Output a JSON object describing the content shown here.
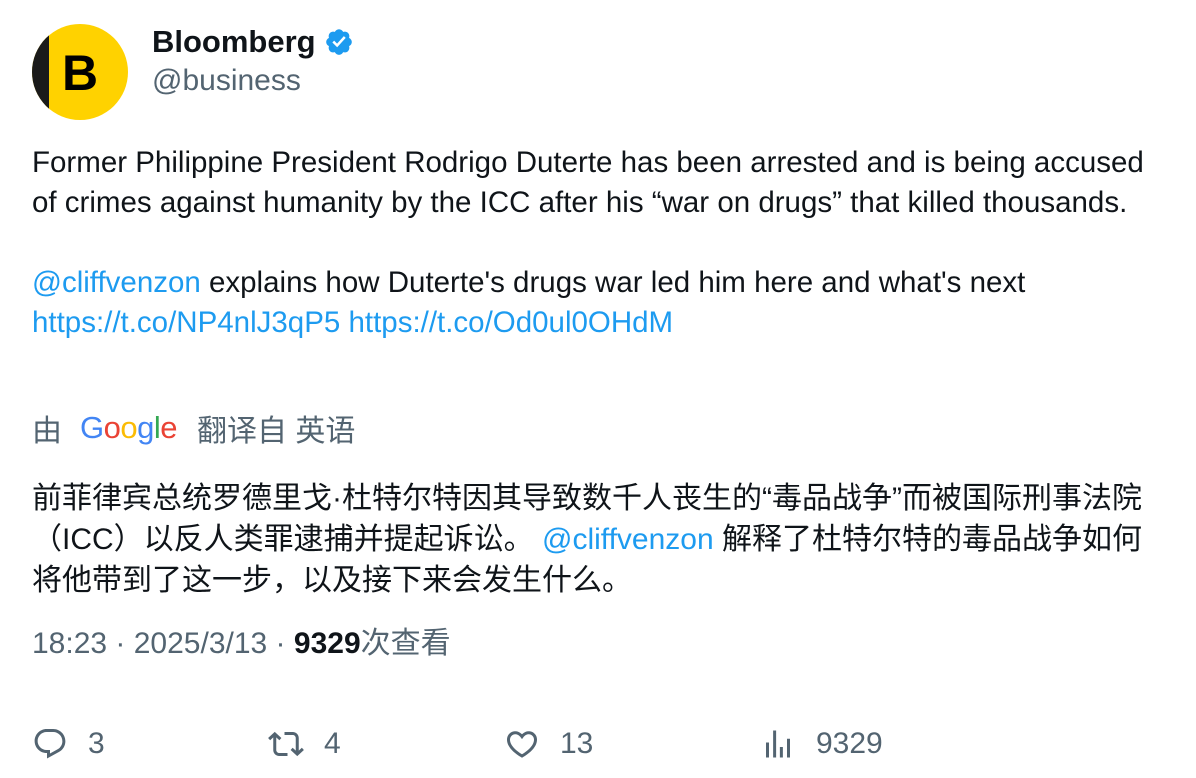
{
  "author": {
    "display_name": "Bloomberg",
    "handle": "@business",
    "avatar_letter": "B",
    "verified": true,
    "avatar_color": "#ffd200",
    "verified_color": "#1d9bf0"
  },
  "tweet": {
    "paragraph1": "Former Philippine President Rodrigo Duterte has been arrested and is being accused of crimes against humanity by the ICC after his “war on drugs” that killed thousands.",
    "mention": "@cliffvenzon",
    "paragraph2_text": " explains how Duterte's drugs war led him here and what's next",
    "link1": "https://t.co/NP4nlJ3qP5",
    "link2": "https://t.co/Od0ul0OHdM"
  },
  "translation": {
    "prefix": "由",
    "provider_letters": [
      "G",
      "o",
      "o",
      "g",
      "l",
      "e"
    ],
    "suffix": "翻译自 英语",
    "text_before": "前菲律宾总统罗德里戈·杜特尔特因其导致数千人丧生的“毒品战争”而被国际刑事法院（ICC）以反人类罪逮捕并提起诉讼。 ",
    "mention": "@cliffvenzon",
    "text_after": " 解释了杜特尔特的毒品战争如何将他带到了这一步，以及接下来会发生什么。"
  },
  "meta": {
    "time": "18:23",
    "separator": " · ",
    "date": "2025/3/13",
    "views_count": "9329",
    "views_label": "次查看"
  },
  "actions": {
    "reply_count": "3",
    "retweet_count": "4",
    "like_count": "13",
    "views_count": "9329"
  },
  "colors": {
    "text": "#0f1419",
    "secondary": "#536471",
    "link": "#1d9bf0"
  }
}
